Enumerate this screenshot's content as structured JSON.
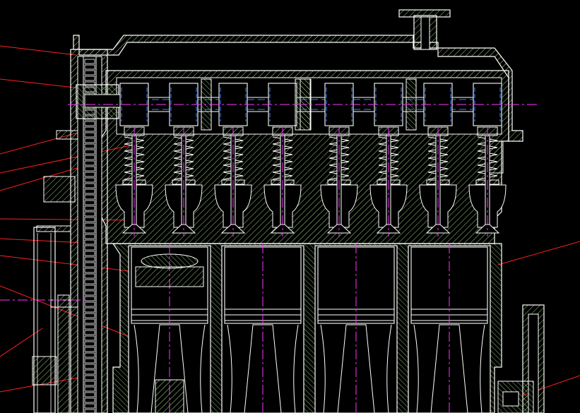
{
  "colors": {
    "background": "#000000",
    "outline": "#ffffff",
    "hatch": "#9fd884",
    "leader": "#ff2020",
    "centerline": "#ff33ff",
    "hidden": "#3a7fff"
  },
  "drawing": {
    "cylinders": 4,
    "cam_lobes": 8,
    "valves": 8
  }
}
